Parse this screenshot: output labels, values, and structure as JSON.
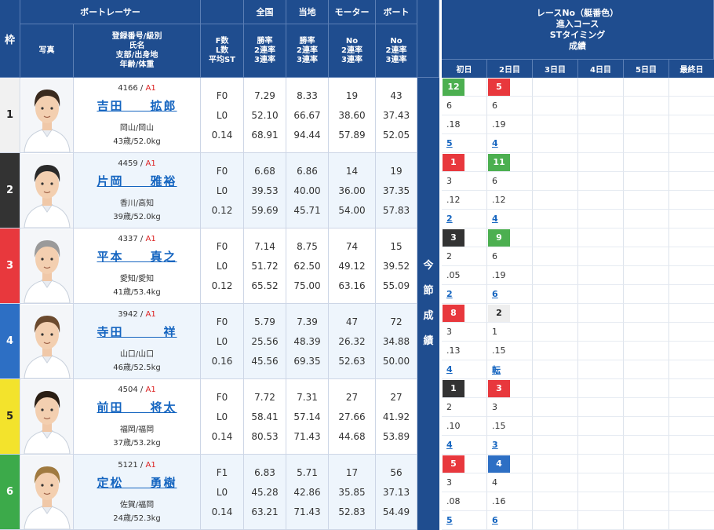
{
  "header": {
    "frame": "枠",
    "boat_racer": "ボートレーサー",
    "photo": "写真",
    "info_lines": [
      "登録番号/級別",
      "氏名",
      "支部/出身地",
      "年齢/体重"
    ],
    "f_lines": [
      "F数",
      "L数",
      "平均ST"
    ],
    "zenkoku": "全国",
    "touchi": "当地",
    "motor": "モーター",
    "boat": "ボート",
    "rate_lines": [
      "勝率",
      "2連率",
      "3連率"
    ],
    "no_lines": [
      "No",
      "2連率",
      "3連率"
    ],
    "konsetsu": [
      "今",
      "節",
      "成",
      "績"
    ],
    "right_title_lines": [
      "レースNo（艇番色）",
      "進入コース",
      "STタイミング",
      "成績"
    ],
    "days": [
      "初日",
      "2日目",
      "3日目",
      "4日目",
      "5日目",
      "最終日"
    ]
  },
  "colors": {
    "header_bg": "#1f4d8f",
    "frame": [
      "#ffffff",
      "#333333",
      "#e8383d",
      "#2d6fc4",
      "#f3e32c",
      "#3caa4a"
    ],
    "badge": {
      "1": "#ffffff",
      "2": "#333333",
      "3": "#e8383d",
      "4": "#2d6fc4",
      "5": "#f3e32c",
      "6": "#3caa4a",
      "7": "#f18c2b",
      "8": "#e8383d",
      "9": "#4caf50",
      "10": "#1f4d8f",
      "11": "#4caf50",
      "12": "#4caf50"
    }
  },
  "racers": [
    {
      "frame": "1",
      "reg": "4166",
      "cls": "A1",
      "name": "吉田　　拡郎",
      "branch": "岡山/岡山",
      "age": "43歳/52.0kg",
      "f": [
        "F0",
        "L0",
        "0.14"
      ],
      "zenkoku": [
        "7.29",
        "52.10",
        "68.91"
      ],
      "touchi": [
        "8.33",
        "66.67",
        "94.44"
      ],
      "motor": [
        "19",
        "38.60",
        "57.89"
      ],
      "boat": [
        "43",
        "37.43",
        "52.05"
      ],
      "results": [
        {
          "race": "12",
          "race_boat": "12",
          "course": "6",
          "st": ".18",
          "rank": "5"
        },
        {
          "race": "5",
          "race_boat": "3",
          "course": "6",
          "st": ".19",
          "rank": "4"
        }
      ]
    },
    {
      "frame": "2",
      "reg": "4459",
      "cls": "A1",
      "name": "片岡　　雅裕",
      "branch": "香川/高知",
      "age": "39歳/52.0kg",
      "f": [
        "F0",
        "L0",
        "0.12"
      ],
      "zenkoku": [
        "6.68",
        "39.53",
        "59.69"
      ],
      "touchi": [
        "6.86",
        "40.00",
        "45.71"
      ],
      "motor": [
        "14",
        "36.00",
        "54.00"
      ],
      "boat": [
        "19",
        "37.35",
        "57.83"
      ],
      "results": [
        {
          "race": "1",
          "race_boat": "3",
          "course": "3",
          "st": ".12",
          "rank": "2"
        },
        {
          "race": "11",
          "race_boat": "11",
          "course": "6",
          "st": ".12",
          "rank": "4"
        }
      ]
    },
    {
      "frame": "3",
      "reg": "4337",
      "cls": "A1",
      "name": "平本　　真之",
      "branch": "愛知/愛知",
      "age": "41歳/53.4kg",
      "f": [
        "F0",
        "L0",
        "0.12"
      ],
      "zenkoku": [
        "7.14",
        "51.72",
        "65.52"
      ],
      "touchi": [
        "8.75",
        "62.50",
        "75.00"
      ],
      "motor": [
        "74",
        "49.12",
        "63.16"
      ],
      "boat": [
        "15",
        "39.52",
        "55.09"
      ],
      "results": [
        {
          "race": "3",
          "race_boat": "2",
          "course": "2",
          "st": ".05",
          "rank": "2"
        },
        {
          "race": "9",
          "race_boat": "9",
          "course": "6",
          "st": ".19",
          "rank": "6"
        }
      ]
    },
    {
      "frame": "4",
      "reg": "3942",
      "cls": "A1",
      "name": "寺田　　　祥",
      "branch": "山口/山口",
      "age": "46歳/52.5kg",
      "f": [
        "F0",
        "L0",
        "0.16"
      ],
      "zenkoku": [
        "5.79",
        "25.56",
        "45.56"
      ],
      "touchi": [
        "7.39",
        "48.39",
        "69.35"
      ],
      "motor": [
        "47",
        "26.32",
        "52.63"
      ],
      "boat": [
        "72",
        "34.88",
        "50.00"
      ],
      "results": [
        {
          "race": "8",
          "race_boat": "8",
          "course": "3",
          "st": ".13",
          "rank": "4"
        },
        {
          "race": "2",
          "race_boat": "1",
          "course": "1",
          "st": ".15",
          "rank": "転"
        }
      ]
    },
    {
      "frame": "5",
      "reg": "4504",
      "cls": "A1",
      "name": "前田　　将太",
      "branch": "福岡/福岡",
      "age": "37歳/53.2kg",
      "f": [
        "F0",
        "L0",
        "0.14"
      ],
      "zenkoku": [
        "7.72",
        "58.41",
        "80.53"
      ],
      "touchi": [
        "7.31",
        "57.14",
        "71.43"
      ],
      "motor": [
        "27",
        "27.66",
        "44.68"
      ],
      "boat": [
        "27",
        "41.92",
        "53.89"
      ],
      "results": [
        {
          "race": "1",
          "race_boat": "2",
          "course": "2",
          "st": ".10",
          "rank": "4"
        },
        {
          "race": "3",
          "race_boat": "3",
          "course": "3",
          "st": ".15",
          "rank": "3"
        }
      ]
    },
    {
      "frame": "6",
      "reg": "5121",
      "cls": "A1",
      "name": "定松　　勇樹",
      "branch": "佐賀/福岡",
      "age": "24歳/52.3kg",
      "f": [
        "F1",
        "L0",
        "0.14"
      ],
      "zenkoku": [
        "6.83",
        "45.28",
        "63.21"
      ],
      "touchi": [
        "5.71",
        "42.86",
        "71.43"
      ],
      "motor": [
        "17",
        "35.85",
        "52.83"
      ],
      "boat": [
        "56",
        "37.13",
        "54.49"
      ],
      "results": [
        {
          "race": "5",
          "race_boat": "3",
          "course": "3",
          "st": ".08",
          "rank": "5"
        },
        {
          "race": "4",
          "race_boat": "4",
          "course": "4",
          "st": ".16",
          "rank": "6"
        }
      ]
    }
  ]
}
